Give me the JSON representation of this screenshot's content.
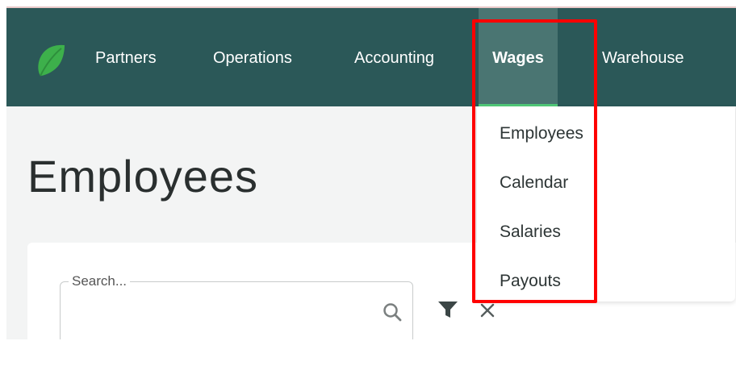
{
  "nav": {
    "items": [
      {
        "label": "Partners"
      },
      {
        "label": "Operations"
      },
      {
        "label": "Accounting"
      },
      {
        "label": "Wages"
      },
      {
        "label": "Warehouse"
      }
    ],
    "active_index": 3
  },
  "wages_menu": {
    "items": [
      {
        "label": "Employees"
      },
      {
        "label": "Calendar"
      },
      {
        "label": "Salaries"
      },
      {
        "label": "Payouts"
      }
    ]
  },
  "page": {
    "title": "Employees"
  },
  "search": {
    "label": "Search...",
    "value": ""
  },
  "icons": {
    "logo": "leaf-logo-icon",
    "search": "search-icon",
    "filter": "filter-icon",
    "clear": "close-icon"
  },
  "colors": {
    "nav_background": "#2b5858",
    "nav_active": "#4a7572",
    "active_underline": "#50c878",
    "logo_green": "#3db04b",
    "highlight": "#ff0000"
  }
}
